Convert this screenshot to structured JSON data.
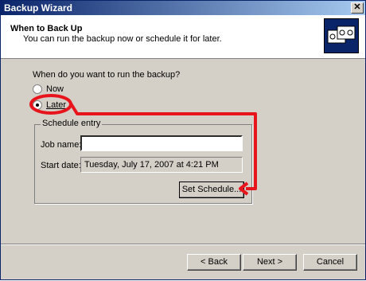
{
  "window": {
    "title": "Backup Wizard",
    "close_glyph": "✕"
  },
  "header": {
    "title": "When to Back Up",
    "subtitle": "You can run the backup now or schedule it for later.",
    "icon": "backup-tapes-icon"
  },
  "prompt": "When do you want to run the backup?",
  "options": [
    {
      "label": "Now",
      "selected": false
    },
    {
      "label": "Later",
      "selected": true
    }
  ],
  "schedule": {
    "group_label": "Schedule entry",
    "job_name_label": "Job name:",
    "job_name_value": "",
    "start_date_label": "Start date:",
    "start_date_value": "Tuesday, July 17, 2007 at 4:21 PM",
    "set_schedule_label": "Set Schedule..."
  },
  "buttons": {
    "back": "< Back",
    "next": "Next >",
    "cancel": "Cancel"
  },
  "annotation_color": "#e8141c"
}
